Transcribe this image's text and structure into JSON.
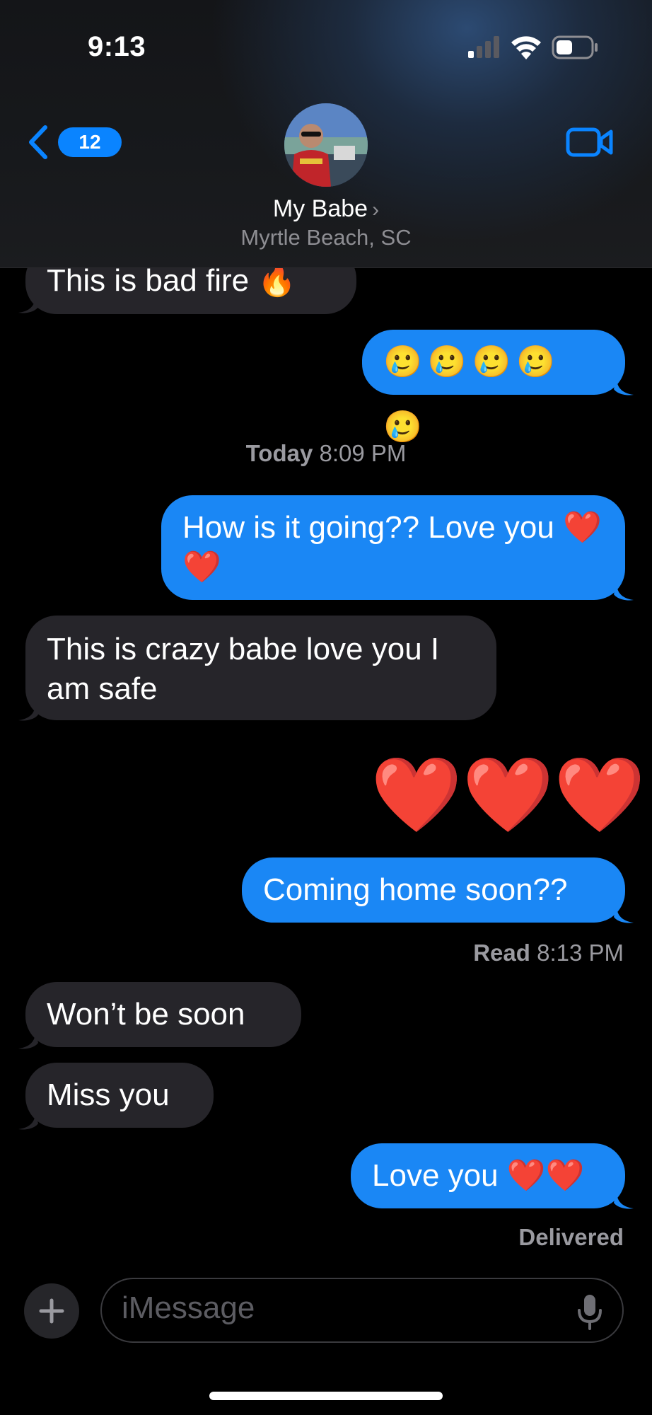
{
  "status_bar": {
    "time": "9:13"
  },
  "header": {
    "back_badge": "12",
    "contact_name": "My Babe",
    "contact_location": "Myrtle Beach, SC"
  },
  "messages": [
    {
      "from": "them",
      "text": "This is bad fire 🔥"
    },
    {
      "from": "me",
      "text": "🥲🥲🥲🥲🥲"
    },
    {
      "from": "me",
      "text": "How is it going?? Love you ❤️❤️"
    },
    {
      "from": "them",
      "text": "This is crazy babe love you I am safe"
    },
    {
      "from": "me",
      "text": "❤️❤️❤️"
    },
    {
      "from": "me",
      "text": "Coming home soon??"
    },
    {
      "from": "them",
      "text": "Won’t be soon"
    },
    {
      "from": "them",
      "text": "Miss you"
    },
    {
      "from": "me",
      "text": "Love you ❤️❤️"
    }
  ],
  "timestamps": {
    "today_label": "Today",
    "today_time": "8:09 PM",
    "read_label": "Read",
    "read_time": "8:13 PM",
    "delivered": "Delivered"
  },
  "input": {
    "placeholder": "iMessage",
    "value": ""
  },
  "colors": {
    "outgoing": "#1a87f5",
    "incoming": "#26252a",
    "accent": "#0a84ff"
  }
}
